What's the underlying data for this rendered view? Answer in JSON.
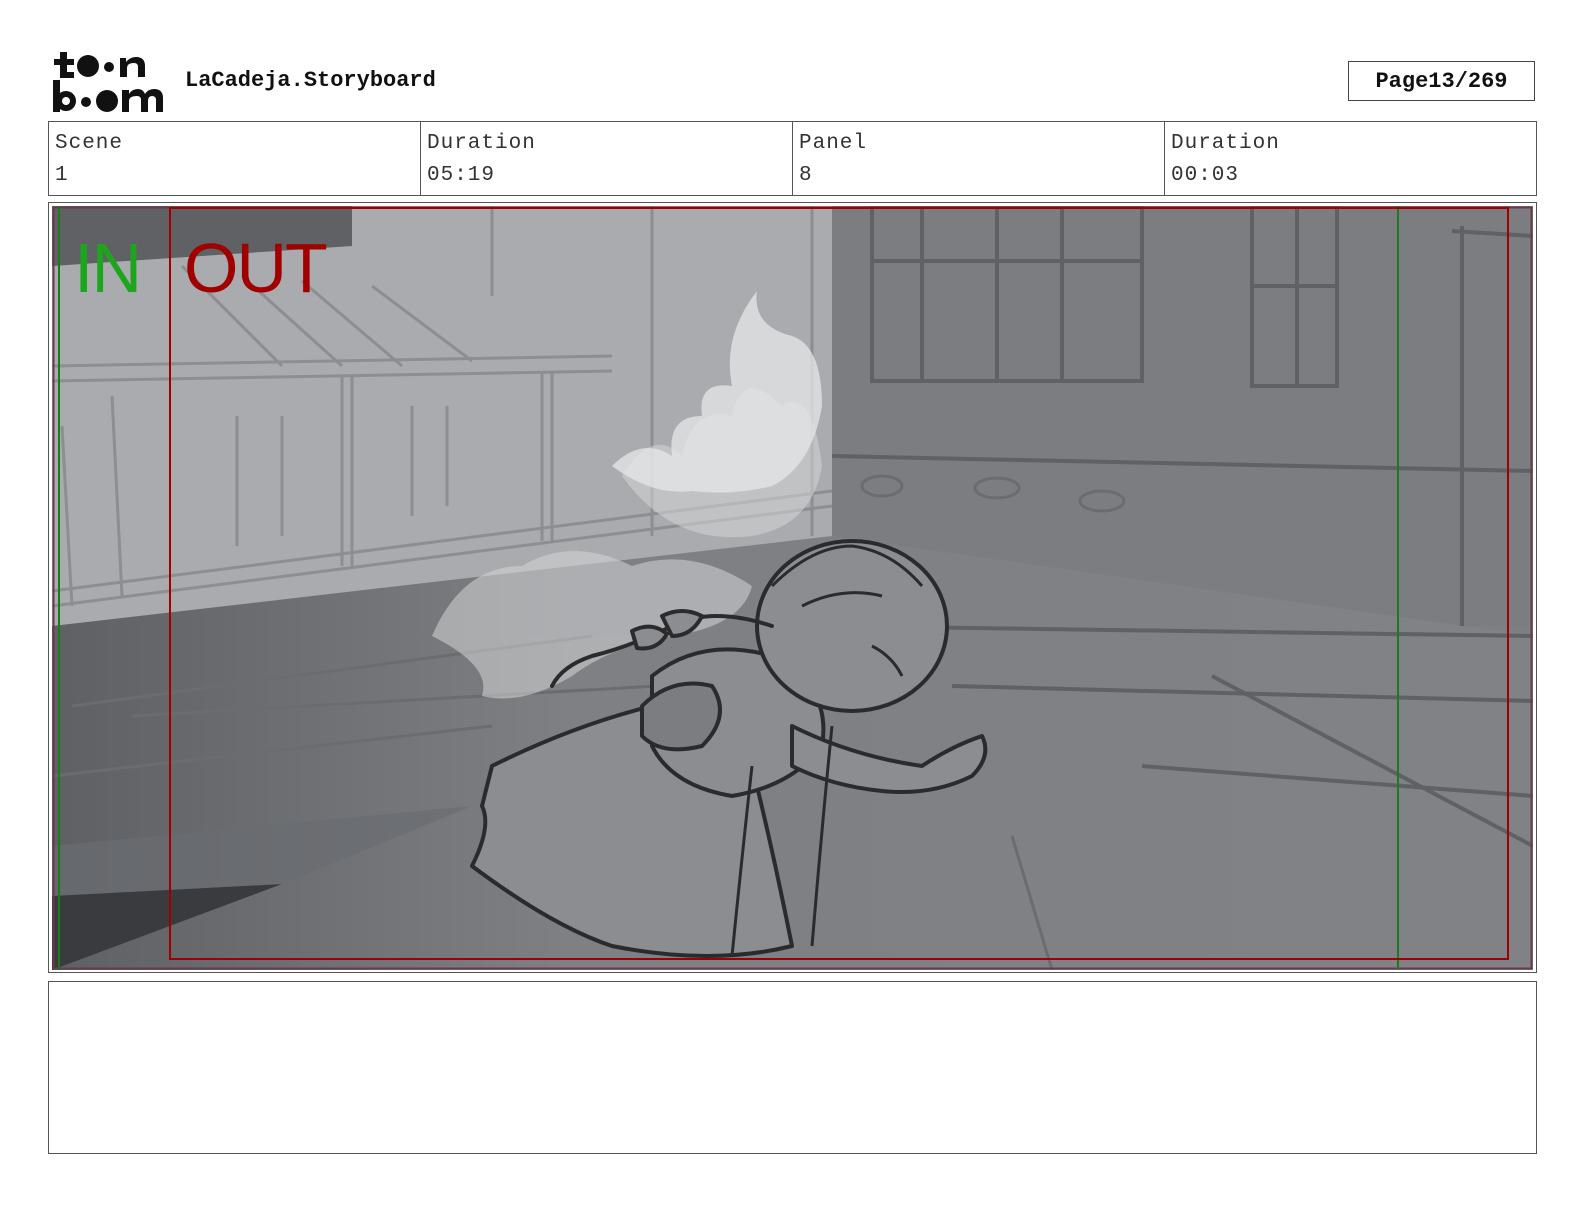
{
  "logo": {
    "line1": "toon",
    "line2": "boom"
  },
  "header": {
    "title": "LaCadeja.Storyboard",
    "page_label": "Page",
    "page_value": "13/269"
  },
  "info": {
    "scene_label": "Scene",
    "scene_value": "1",
    "scene_duration_label": "Duration",
    "scene_duration_value": "05:19",
    "panel_label": "Panel",
    "panel_value": "8",
    "panel_duration_label": "Duration",
    "panel_duration_value": "00:03"
  },
  "frame": {
    "in_label": "IN",
    "out_label": "OUT",
    "in_color": "#1ea51e",
    "out_color": "#a00000"
  },
  "notes": ""
}
